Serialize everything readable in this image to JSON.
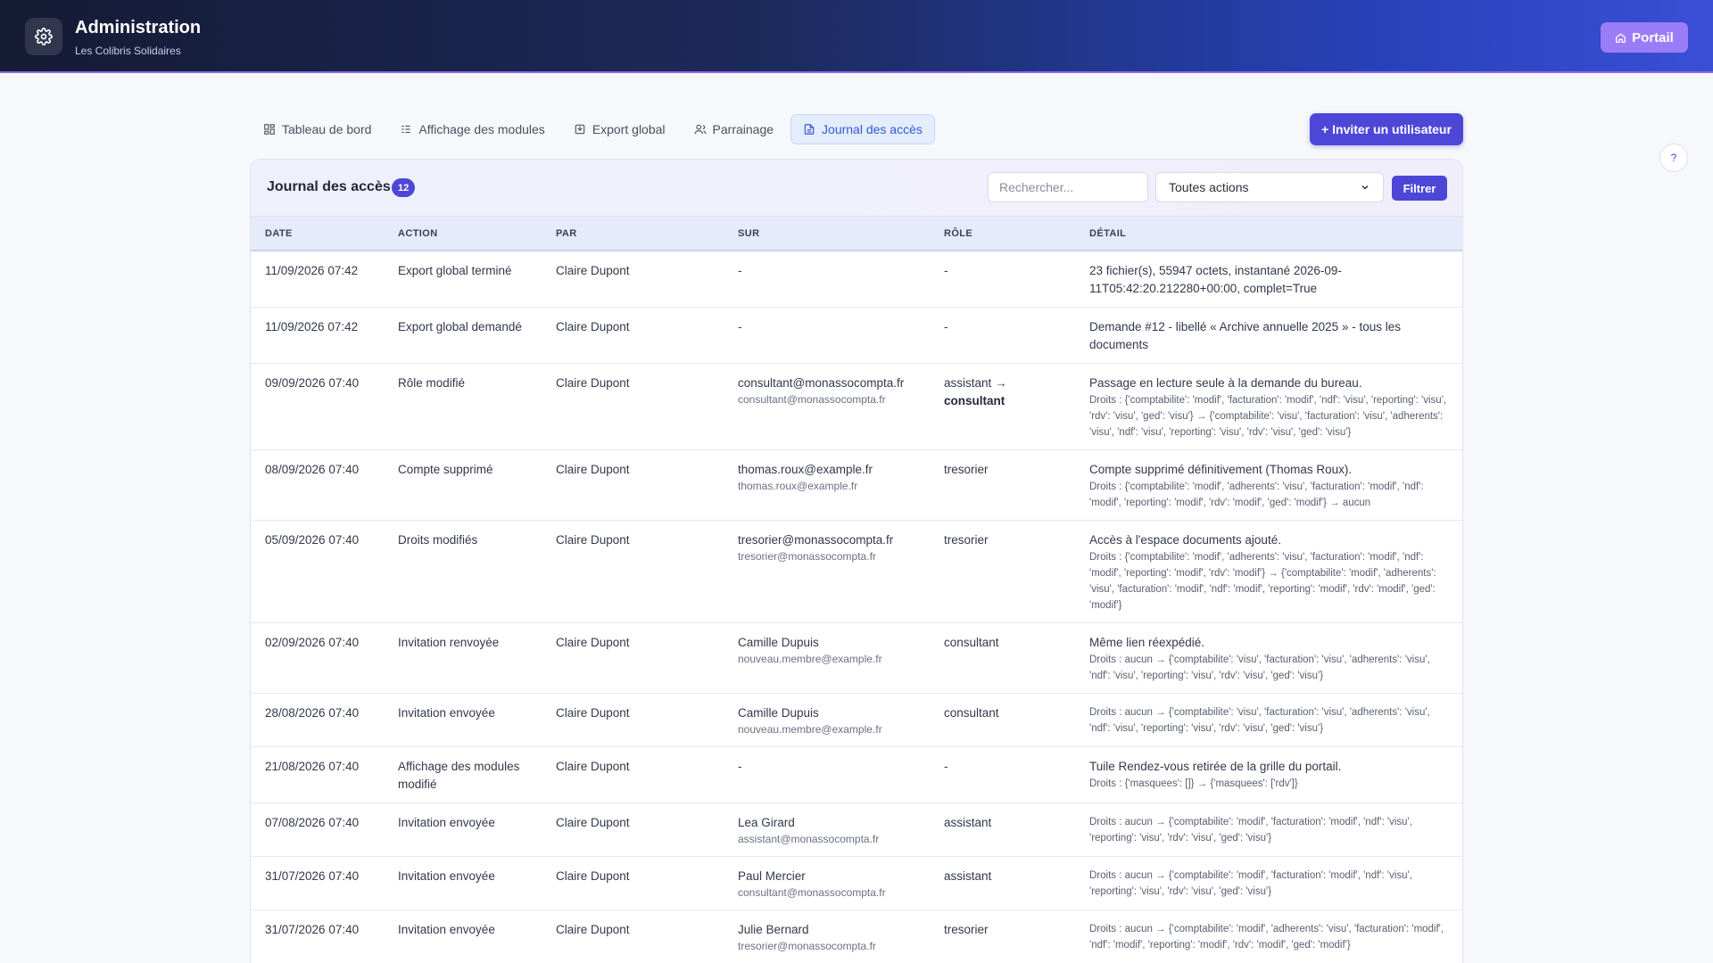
{
  "header": {
    "title": "Administration",
    "subtitle": "Les Colibris Solidaires",
    "portal_label": "Portail"
  },
  "tabs": [
    {
      "label": "Tableau de bord",
      "icon": "dashboard-icon"
    },
    {
      "label": "Affichage des modules",
      "icon": "list-icon"
    },
    {
      "label": "Export global",
      "icon": "export-icon"
    },
    {
      "label": "Parrainage",
      "icon": "users-icon"
    },
    {
      "label": "Journal des accès",
      "icon": "document-icon",
      "active": true
    }
  ],
  "invite_label": "+ Inviter un utilisateur",
  "help_label": "?",
  "panel": {
    "title": "Journal des accès",
    "count": "12",
    "search_placeholder": "Rechercher...",
    "action_select": "Toutes actions",
    "filter_label": "Filtrer"
  },
  "columns": [
    "DATE",
    "ACTION",
    "PAR",
    "SUR",
    "RÔLE",
    "DÉTAIL"
  ],
  "rows": [
    {
      "date": "11/09/2026 07:42",
      "action": "Export global terminé",
      "par": "Claire Dupont",
      "sur": "-",
      "sur_sub": "",
      "role": "-",
      "role2": "",
      "detail": "23 fichier(s), 55947 octets, instantané 2026-09-11T05:42:20.212280+00:00, complet=True",
      "rights": ""
    },
    {
      "date": "11/09/2026 07:42",
      "action": "Export global demandé",
      "par": "Claire Dupont",
      "sur": "-",
      "sur_sub": "",
      "role": "-",
      "role2": "",
      "detail": "Demande #12 - libellé « Archive annuelle 2025 » - tous les documents",
      "rights": ""
    },
    {
      "date": "09/09/2026 07:40",
      "action": "Rôle modifié",
      "par": "Claire Dupont",
      "sur": "consultant@monassocompta.fr",
      "sur_sub": "consultant@monassocompta.fr",
      "role": "assistant →",
      "role2": "consultant",
      "detail": "Passage en lecture seule à la demande du bureau.",
      "rights": "Droits : {'comptabilite': 'modif', 'facturation': 'modif', 'ndf': 'visu', 'reporting': 'visu', 'rdv': 'visu', 'ged': 'visu'} → {'comptabilite': 'visu', 'facturation': 'visu', 'adherents': 'visu', 'ndf': 'visu', 'reporting': 'visu', 'rdv': 'visu', 'ged': 'visu'}"
    },
    {
      "date": "08/09/2026 07:40",
      "action": "Compte supprimé",
      "par": "Claire Dupont",
      "sur": "thomas.roux@example.fr",
      "sur_sub": "thomas.roux@example.fr",
      "role": "tresorier",
      "role2": "",
      "detail": "Compte supprimé définitivement (Thomas Roux).",
      "rights": "Droits : {'comptabilite': 'modif', 'adherents': 'visu', 'facturation': 'modif', 'ndf': 'modif', 'reporting': 'modif', 'rdv': 'modif', 'ged': 'modif'} → aucun"
    },
    {
      "date": "05/09/2026 07:40",
      "action": "Droits modifiés",
      "par": "Claire Dupont",
      "sur": "tresorier@monassocompta.fr",
      "sur_sub": "tresorier@monassocompta.fr",
      "role": "tresorier",
      "role2": "",
      "detail": "Accès à l'espace documents ajouté.",
      "rights": "Droits : {'comptabilite': 'modif', 'adherents': 'visu', 'facturation': 'modif', 'ndf': 'modif', 'reporting': 'modif', 'rdv': 'modif'} → {'comptabilite': 'modif', 'adherents': 'visu', 'facturation': 'modif', 'ndf': 'modif', 'reporting': 'modif', 'rdv': 'modif', 'ged': 'modif'}"
    },
    {
      "date": "02/09/2026 07:40",
      "action": "Invitation renvoyée",
      "par": "Claire Dupont",
      "sur": "Camille Dupuis",
      "sur_sub": "nouveau.membre@example.fr",
      "role": "consultant",
      "role2": "",
      "detail": "Même lien réexpédié.",
      "rights": "Droits : aucun → {'comptabilite': 'visu', 'facturation': 'visu', 'adherents': 'visu', 'ndf': 'visu', 'reporting': 'visu', 'rdv': 'visu', 'ged': 'visu'}"
    },
    {
      "date": "28/08/2026 07:40",
      "action": "Invitation envoyée",
      "par": "Claire Dupont",
      "sur": "Camille Dupuis",
      "sur_sub": "nouveau.membre@example.fr",
      "role": "consultant",
      "role2": "",
      "detail": "",
      "rights": "Droits : aucun → {'comptabilite': 'visu', 'facturation': 'visu', 'adherents': 'visu', 'ndf': 'visu', 'reporting': 'visu', 'rdv': 'visu', 'ged': 'visu'}"
    },
    {
      "date": "21/08/2026 07:40",
      "action": "Affichage des modules modifié",
      "par": "Claire Dupont",
      "sur": "-",
      "sur_sub": "",
      "role": "-",
      "role2": "",
      "detail": "Tuile Rendez-vous retirée de la grille du portail.",
      "rights": "Droits : {'masquees': []} → {'masquees': ['rdv']}"
    },
    {
      "date": "07/08/2026 07:40",
      "action": "Invitation envoyée",
      "par": "Claire Dupont",
      "sur": "Lea Girard",
      "sur_sub": "assistant@monassocompta.fr",
      "role": "assistant",
      "role2": "",
      "detail": "",
      "rights": "Droits : aucun → {'comptabilite': 'modif', 'facturation': 'modif', 'ndf': 'visu', 'reporting': 'visu', 'rdv': 'visu', 'ged': 'visu'}"
    },
    {
      "date": "31/07/2026 07:40",
      "action": "Invitation envoyée",
      "par": "Claire Dupont",
      "sur": "Paul Mercier",
      "sur_sub": "consultant@monassocompta.fr",
      "role": "assistant",
      "role2": "",
      "detail": "",
      "rights": "Droits : aucun → {'comptabilite': 'modif', 'facturation': 'modif', 'ndf': 'visu', 'reporting': 'visu', 'rdv': 'visu', 'ged': 'visu'}"
    },
    {
      "date": "31/07/2026 07:40",
      "action": "Invitation envoyée",
      "par": "Claire Dupont",
      "sur": "Julie Bernard",
      "sur_sub": "tresorier@monassocompta.fr",
      "role": "tresorier",
      "role2": "",
      "detail": "",
      "rights": "Droits : aucun → {'comptabilite': 'modif', 'adherents': 'visu', 'facturation': 'modif', 'ndf': 'modif', 'reporting': 'modif', 'rdv': 'modif', 'ged': 'modif'}"
    }
  ]
}
